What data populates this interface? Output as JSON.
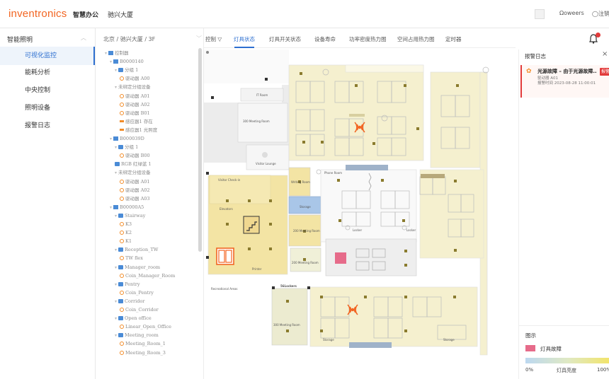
{
  "app": {
    "logo": "inventronics",
    "product": "智慧办公",
    "building": "驰兴大厦",
    "user": "Ωoweers",
    "logout": "◯注销"
  },
  "menu": {
    "header": "智能照明",
    "items": [
      {
        "label": "可视化监控",
        "active": true
      },
      {
        "label": "能耗分析",
        "active": false
      },
      {
        "label": "中央控制",
        "active": false
      },
      {
        "label": "照明设备",
        "active": false
      },
      {
        "label": "报警日志",
        "active": false
      }
    ]
  },
  "tree": {
    "path": "北京 / 驰兴大厦 / 3F",
    "rows": [
      {
        "text": "控制器",
        "icon": "grid",
        "indent": 0,
        "caret": true
      },
      {
        "text": "B0000140",
        "icon": "grid",
        "indent": 1,
        "caret": true
      },
      {
        "text": "分组 1",
        "icon": "folder",
        "indent": 2,
        "caret": true
      },
      {
        "text": "驱动器 A00",
        "icon": "bulb",
        "indent": 3,
        "caret": false
      },
      {
        "text": "未绑定分组设备",
        "icon": "none",
        "indent": 2,
        "caret": true
      },
      {
        "text": "驱动器 A01",
        "icon": "bulb",
        "indent": 3,
        "caret": false
      },
      {
        "text": "驱动器 A02",
        "icon": "bulb",
        "indent": 3,
        "caret": false
      },
      {
        "text": "驱动器 B01",
        "icon": "bulb",
        "indent": 3,
        "caret": false
      },
      {
        "text": "感应器1 存在",
        "icon": "sensor",
        "indent": 3,
        "caret": false
      },
      {
        "text": "感应器1 光照度",
        "icon": "sensor",
        "indent": 3,
        "caret": false
      },
      {
        "text": "B000039D",
        "icon": "grid",
        "indent": 1,
        "caret": true
      },
      {
        "text": "分组 1",
        "icon": "folder",
        "indent": 2,
        "caret": true
      },
      {
        "text": "驱动器 B00",
        "icon": "bulb",
        "indent": 3,
        "caret": false
      },
      {
        "text": "RGB 红绿蓝 1",
        "icon": "folder",
        "indent": 2,
        "caret": false
      },
      {
        "text": "未绑定分组设备",
        "icon": "none",
        "indent": 2,
        "caret": true
      },
      {
        "text": "驱动器 A01",
        "icon": "bulb",
        "indent": 3,
        "caret": false
      },
      {
        "text": "驱动器 A02",
        "icon": "bulb",
        "indent": 3,
        "caret": false
      },
      {
        "text": "驱动器 A03",
        "icon": "bulb",
        "indent": 3,
        "caret": false
      },
      {
        "text": "B00000A5",
        "icon": "grid",
        "indent": 1,
        "caret": true
      },
      {
        "text": "Stairway",
        "icon": "folder",
        "indent": 2,
        "caret": true
      },
      {
        "text": "K3",
        "icon": "bulb",
        "indent": 3,
        "caret": false
      },
      {
        "text": "K2",
        "icon": "bulb",
        "indent": 3,
        "caret": false
      },
      {
        "text": "K1",
        "icon": "bulb",
        "indent": 3,
        "caret": false
      },
      {
        "text": "Reception_TW",
        "icon": "folder",
        "indent": 2,
        "caret": true
      },
      {
        "text": "TW flex",
        "icon": "bulb",
        "indent": 3,
        "caret": false
      },
      {
        "text": "Manager_room",
        "icon": "folder",
        "indent": 2,
        "caret": true
      },
      {
        "text": "Coin_Manager_Room",
        "icon": "bulb",
        "indent": 3,
        "caret": false
      },
      {
        "text": "Pentry",
        "icon": "folder",
        "indent": 2,
        "caret": true
      },
      {
        "text": "Coin_Pentry",
        "icon": "bulb",
        "indent": 3,
        "caret": false
      },
      {
        "text": "Corridor",
        "icon": "folder",
        "indent": 2,
        "caret": true
      },
      {
        "text": "Coin_Corridor",
        "icon": "bulb",
        "indent": 3,
        "caret": false
      },
      {
        "text": "Open office",
        "icon": "folder",
        "indent": 2,
        "caret": true
      },
      {
        "text": "Linear_Open_Office",
        "icon": "bulb",
        "indent": 3,
        "caret": false
      },
      {
        "text": "Meeting_room",
        "icon": "folder",
        "indent": 2,
        "caret": true
      },
      {
        "text": "Meeting_Room_1",
        "icon": "bulb",
        "indent": 3,
        "caret": false
      },
      {
        "text": "Meeting_Room_3",
        "icon": "bulb",
        "indent": 3,
        "caret": false
      }
    ]
  },
  "tabs": [
    {
      "label": "控制 ▽",
      "active": false
    },
    {
      "label": "灯具状态",
      "active": true
    },
    {
      "label": "灯具开关状态",
      "active": false
    },
    {
      "label": "设备寿命",
      "active": false
    },
    {
      "label": "功率密度热力图",
      "active": false
    },
    {
      "label": "空间占用热力图",
      "active": false
    },
    {
      "label": "定时器",
      "active": false
    }
  ],
  "map": {
    "rooms": {
      "it_room": "IT Room",
      "meeting_300": "300 Meeting Room",
      "visitor_lounge": "Visitor Lounge",
      "visitor_check_in": "Visitor Check-in",
      "elevators": "Elevators",
      "printer": "Printer",
      "storage": "Storage",
      "writing_room": "Writing Room",
      "meeting_200_a": "200 Meeting Room",
      "meeting_200_b": "200 Meeting Room",
      "phone_room": "Phone Room",
      "locker_a": "Locker",
      "locker_b": "Locker",
      "recreational": "Recreational Areas",
      "lockers_56": "56Lockers",
      "meeting_300_b": "300 Meeting Room",
      "storage_b": "Storage",
      "storage_c": "Storage"
    }
  },
  "alarm": {
    "title": "报警日志",
    "close": "×",
    "card_title": "光源故障 – 由于光源故障...",
    "card_device": "驱动器 A01",
    "card_time": "报警时间 2023-08-28 11:00:01",
    "card_badge": "报警"
  },
  "legend": {
    "title": "图示",
    "fault_label": "灯具故障",
    "min": "0%",
    "mid": "灯具亮度",
    "max": "100%"
  },
  "colors": {
    "accent": "#2d6fd0",
    "brand": "#f26522",
    "fault": "#e66b8a",
    "alarm": "#e23b3b"
  }
}
